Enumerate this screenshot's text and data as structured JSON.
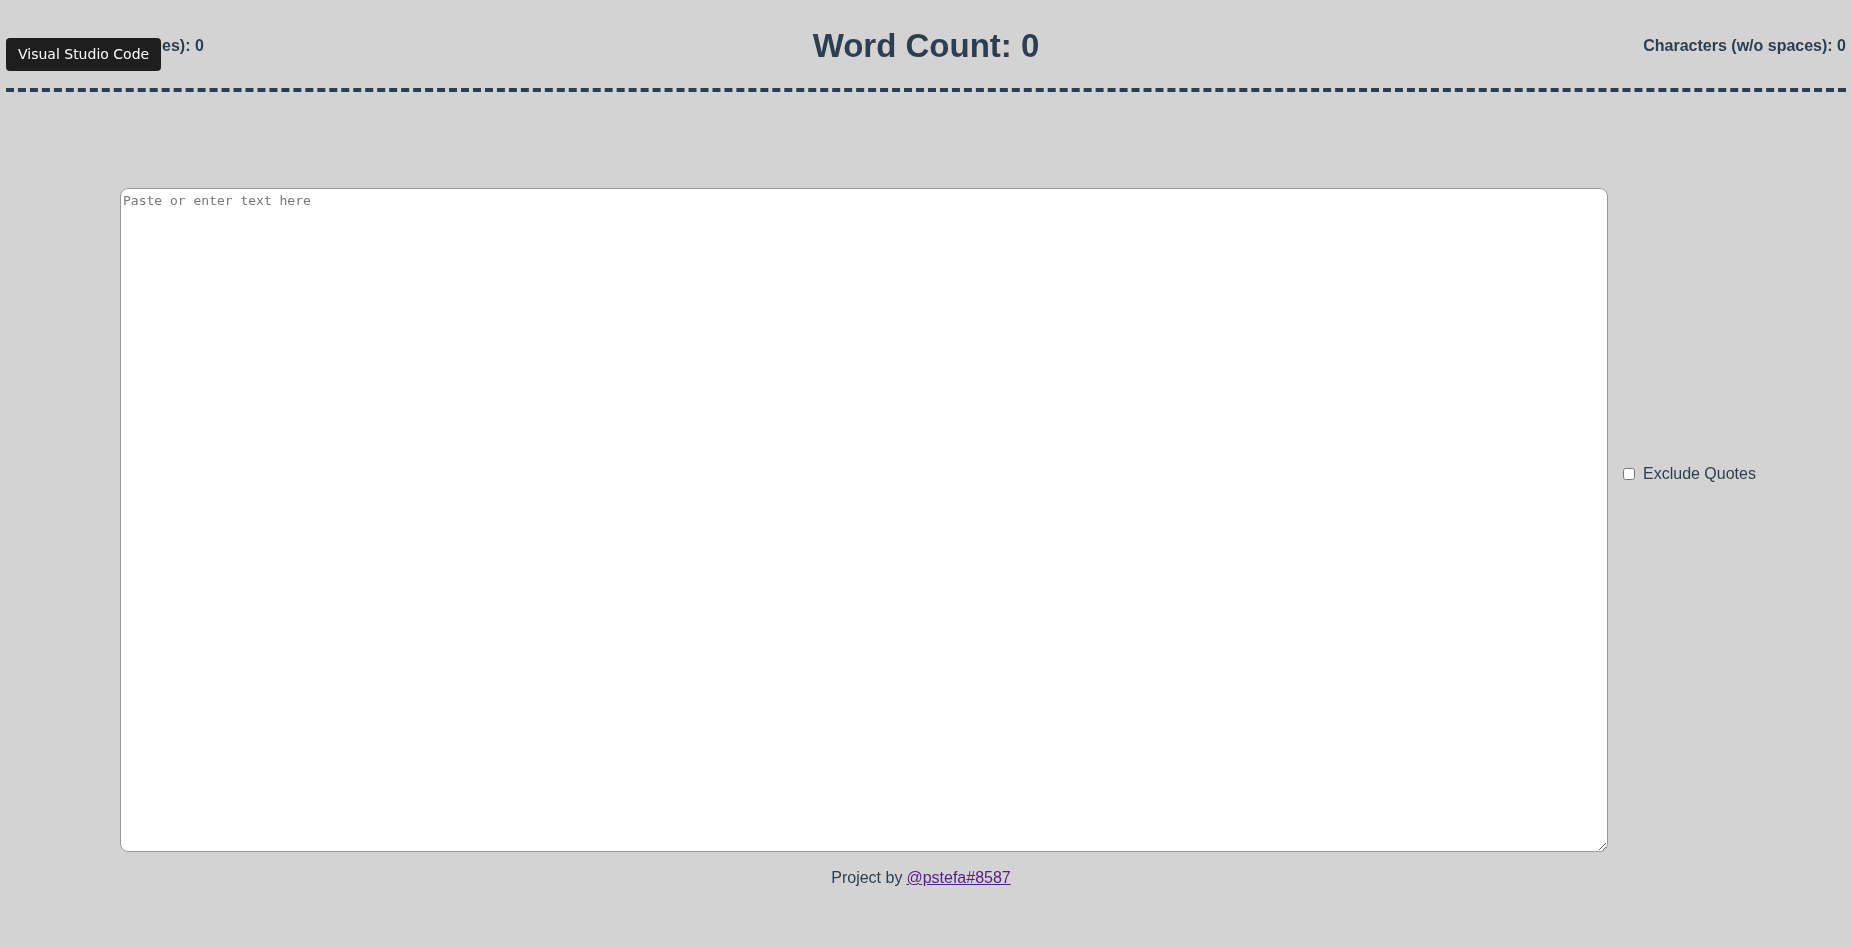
{
  "header": {
    "left_stat": "es): 0",
    "title": "Word Count: 0",
    "right_stat": "Characters (w/o spaces): 0"
  },
  "tooltip": {
    "text": "Visual Studio Code"
  },
  "editor": {
    "placeholder": "Paste or enter text here"
  },
  "options": [
    {
      "label": "Exclude Quotes",
      "checked": false
    }
  ],
  "footer": {
    "text": "Project by",
    "link": "@pstefa#8587"
  }
}
